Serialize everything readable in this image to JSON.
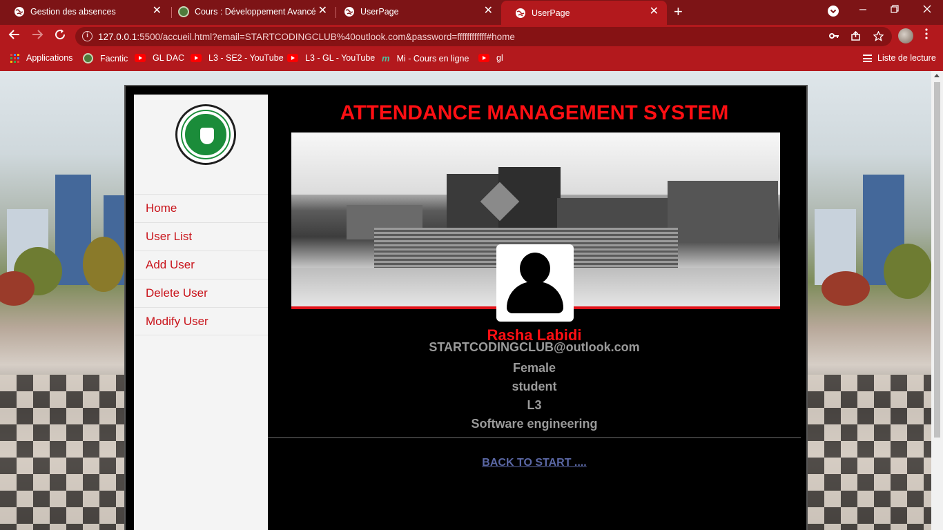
{
  "browser": {
    "tabs": [
      {
        "title": "Gestion des absences",
        "close": "✕"
      },
      {
        "title": "Cours : Développement Avancé c",
        "close": "✕"
      },
      {
        "title": "UserPage",
        "close": "✕"
      },
      {
        "title": "UserPage",
        "close": "✕"
      }
    ],
    "new_tab": "+",
    "url_host": "127.0.0.1",
    "url_rest": ":5500/accueil.html?email=STARTCODINGCLUB%40outlook.com&password=ffffffffffff#home",
    "bookmarks": [
      {
        "label": "Applications",
        "icon": "apps-grid-icon"
      },
      {
        "label": "Facntic",
        "icon": "site-icon"
      },
      {
        "label": "GL DAC",
        "icon": "youtube-icon"
      },
      {
        "label": "L3 - SE2 - YouTube",
        "icon": "youtube-icon"
      },
      {
        "label": "L3 - GL - YouTube",
        "icon": "youtube-icon"
      },
      {
        "label": "Mi - Cours en ligne",
        "icon": "moodle-icon"
      },
      {
        "label": "gl",
        "icon": "youtube-icon"
      }
    ],
    "reading_list": "Liste de lecture",
    "accent_color": "#b3191d",
    "tabbar_color": "#7d1416"
  },
  "app": {
    "title": "ATTENDANCE MANAGEMENT SYSTEM",
    "menu": [
      "Home",
      "User List",
      "Add User",
      "Delete User",
      "Modify User"
    ],
    "user": {
      "name": "Rasha Labidi",
      "email": "STARTCODINGCLUB@outlook.com",
      "gender": "Female",
      "role": "student",
      "level": "L3",
      "speciality": "Software engineering"
    },
    "back_link": "BACK TO START ....",
    "accent_color": "#ff0f13",
    "menu_color": "#c9141b"
  }
}
